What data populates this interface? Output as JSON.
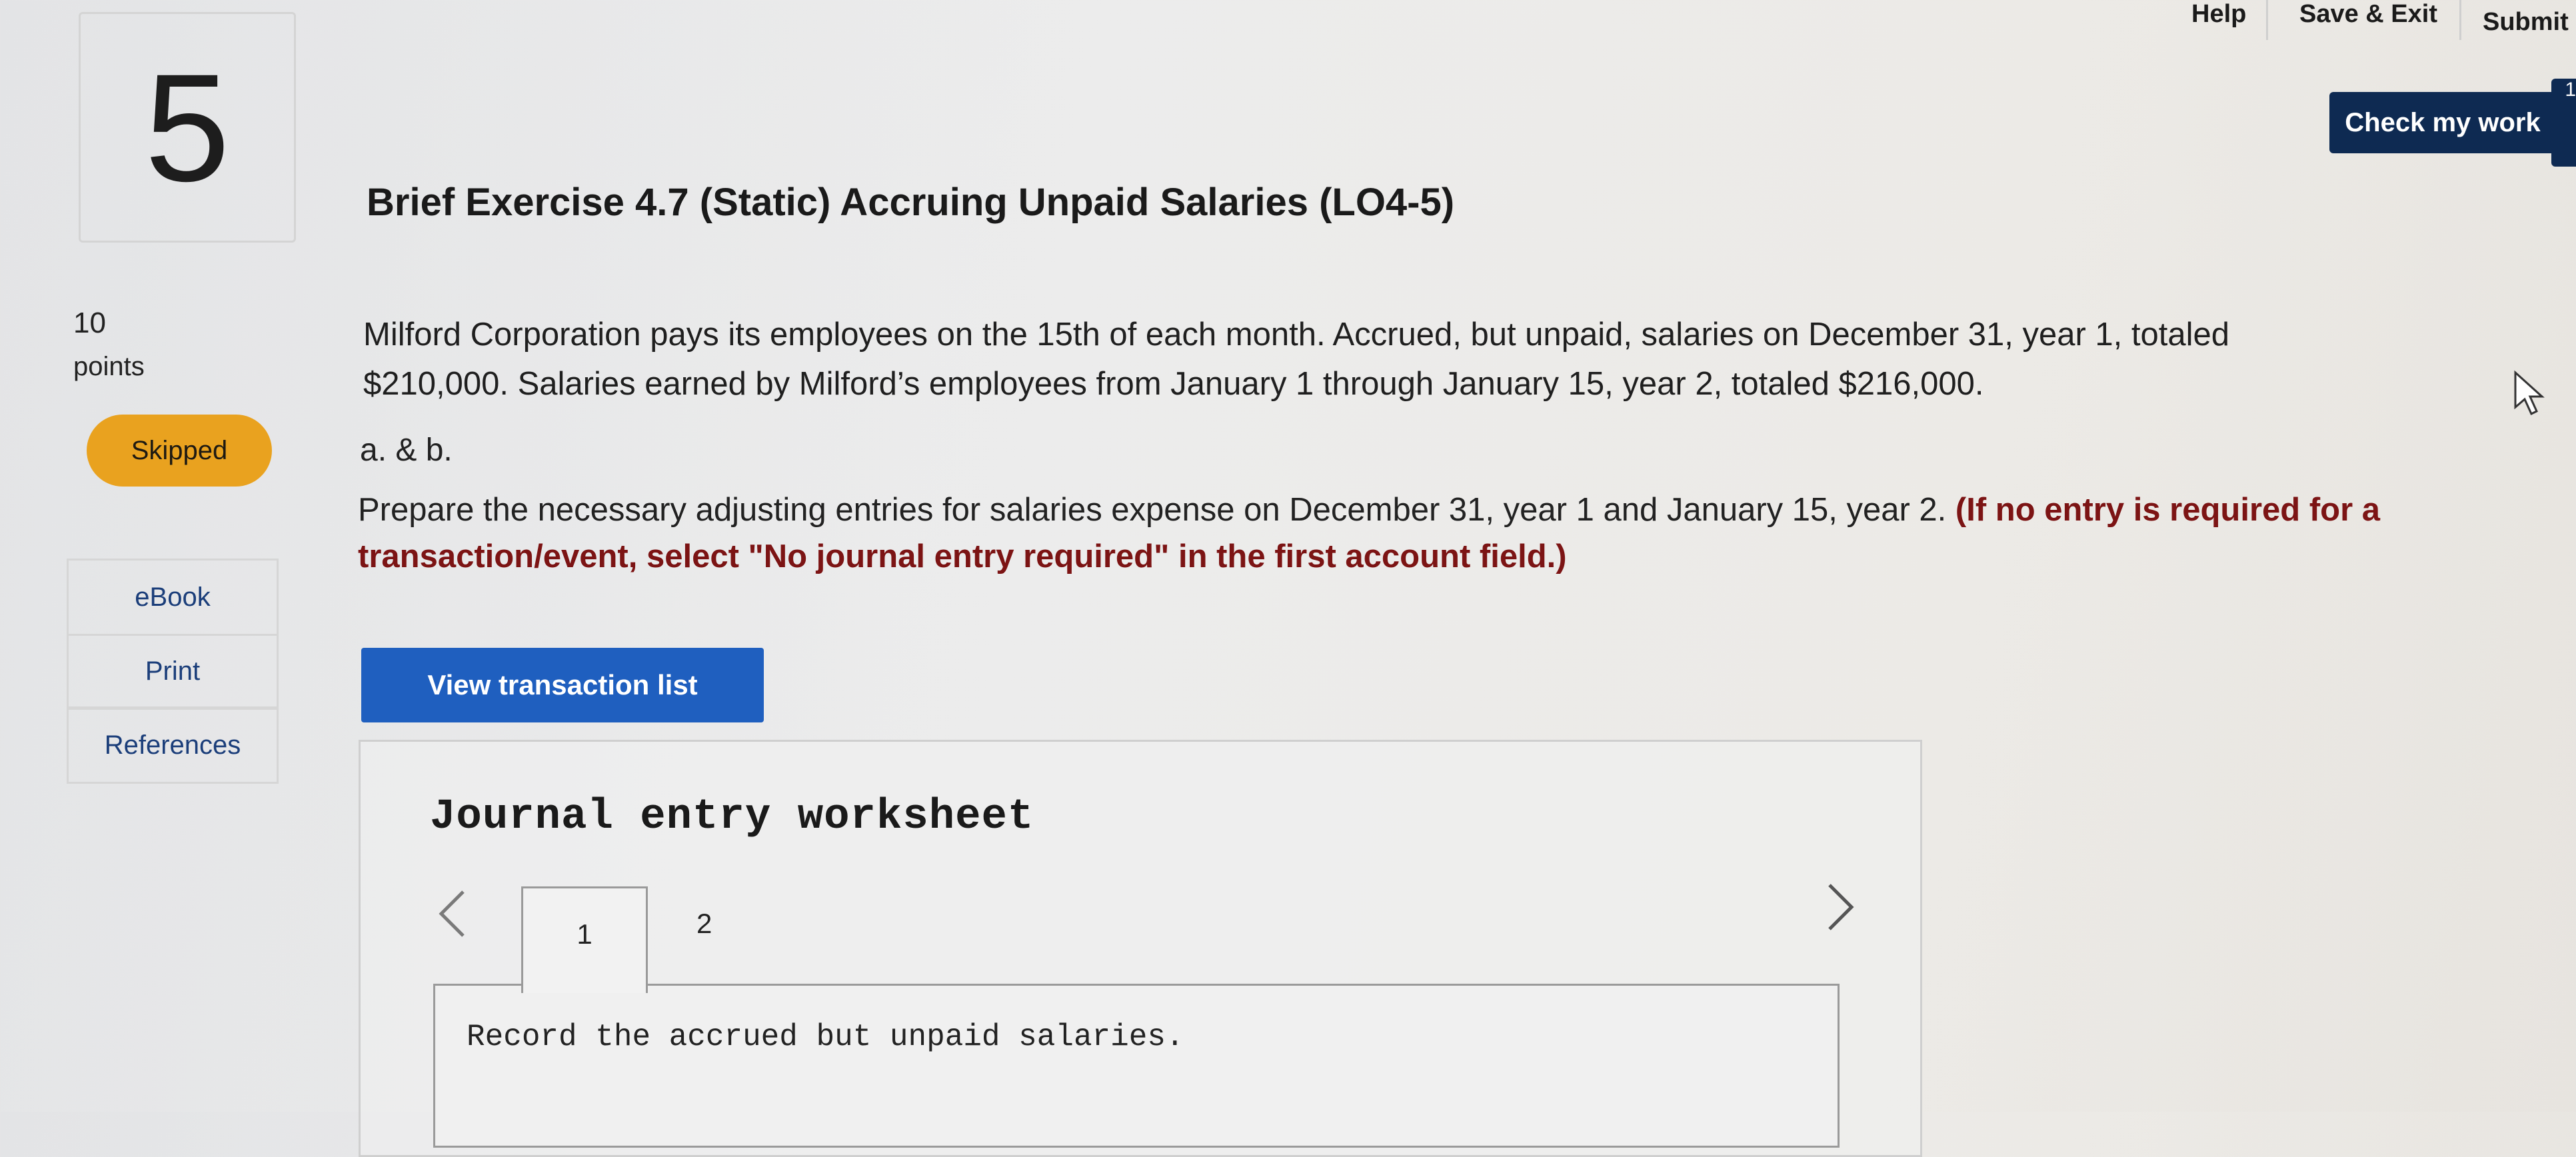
{
  "topbar": {
    "help": "Help",
    "save_exit": "Save & Exit",
    "submit": "Submit"
  },
  "check_my_work": "Check my work",
  "badge_count": "1",
  "question": {
    "number": "5",
    "title": "Brief Exercise 4.7 (Static) Accruing Unpaid Salaries (LO4-5)",
    "points_value": "10",
    "points_label": "points",
    "status": "Skipped"
  },
  "side_links": [
    "eBook",
    "Print",
    "References"
  ],
  "body": {
    "line1": "Milford Corporation pays its employees on the 15th of each month. Accrued, but unpaid, salaries on December 31, year 1, totaled",
    "line2": "$210,000. Salaries earned by Milford’s employees from January 1 through January 15, year 2, totaled $216,000.",
    "part_label": "a. & b.",
    "instruction": "Prepare the necessary adjusting entries for salaries expense on December 31, year 1 and January 15, year 2.",
    "instruction_note": "(If no entry is required for a transaction/event, select \"No journal entry required\" in the first account field.)"
  },
  "view_transaction_list": "View transaction list",
  "worksheet": {
    "title": "Journal entry worksheet",
    "tabs": [
      "1",
      "2"
    ],
    "active_tab": "1",
    "record_text": "Record the accrued but unpaid salaries."
  },
  "icons": {
    "prev": "chevron-left-icon",
    "next": "chevron-right-icon",
    "pointer": "mouse-cursor-icon"
  }
}
